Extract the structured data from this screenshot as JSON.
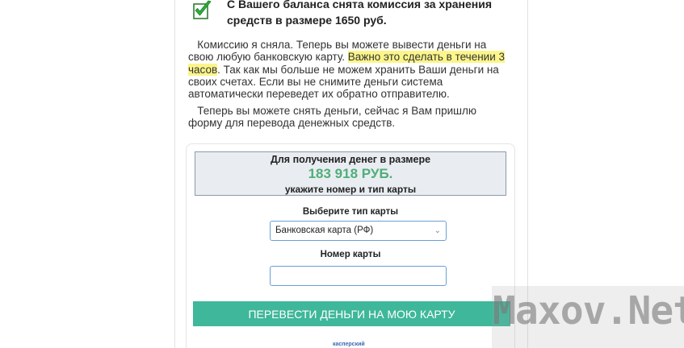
{
  "notice": {
    "title": "С Вашего баланса снята комиссия за хранения средств в размере 1650 руб."
  },
  "message": {
    "para1_before": "Комиссию я сняла. Теперь вы можете вывести деньги на свою любую банковскую карту. ",
    "para1_highlight": "Важно это сделать в течении 3 часов",
    "para1_after": ". Так как мы больше не можем хранить Ваши деньги на своих счетах. Если вы не снимите деньги система автоматически переведет их обратно отправителю.",
    "para2": "Теперь вы можете снять деньги, сейчас я Вам пришлю форму для перевода денежных средств."
  },
  "form": {
    "amount_title": "Для получения денег в размере",
    "amount_value": "183 918 РУБ.",
    "amount_subtitle": "укажите номер и тип карты",
    "card_type_label": "Выберите тип карты",
    "card_type_selected": "Банковская карта (РФ)",
    "card_number_label": "Номер карты",
    "card_number_value": "",
    "submit_label": "ПЕРЕВЕСТИ ДЕНЬГИ НА МОЮ КАРТУ"
  },
  "footer": {
    "logo_text": "касперский"
  },
  "watermark": {
    "text": "Maxov.Net"
  },
  "colors": {
    "accent_button": "#3fb79a",
    "amount_green": "#4fae7a",
    "highlight_yellow": "#fbf58a",
    "input_border": "#6a9fd4"
  },
  "icons": {
    "check": "check-icon",
    "chevron": "chevron-down-icon"
  }
}
